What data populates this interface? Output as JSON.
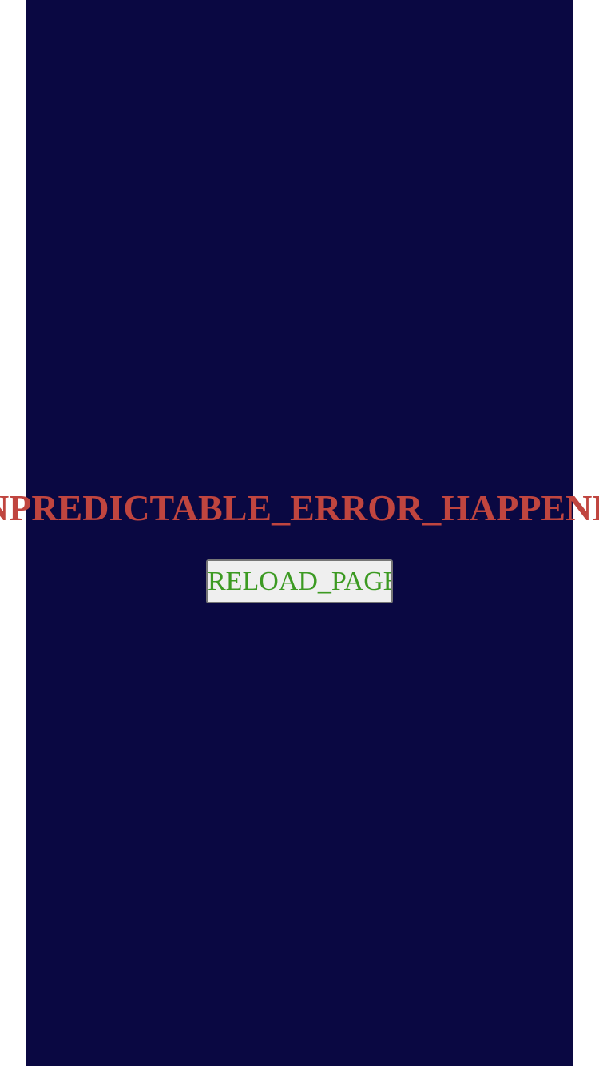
{
  "error": {
    "message": "UNPREDICTABLE_ERROR_HAPPENED"
  },
  "actions": {
    "reload_label": "RELOAD_PAGE"
  },
  "colors": {
    "page_background": "#ffffff",
    "screen_background": "#0a0842",
    "error_text": "#c0453f",
    "button_text": "#3c9a22",
    "button_background": "#efefef",
    "button_border": "#767676"
  }
}
